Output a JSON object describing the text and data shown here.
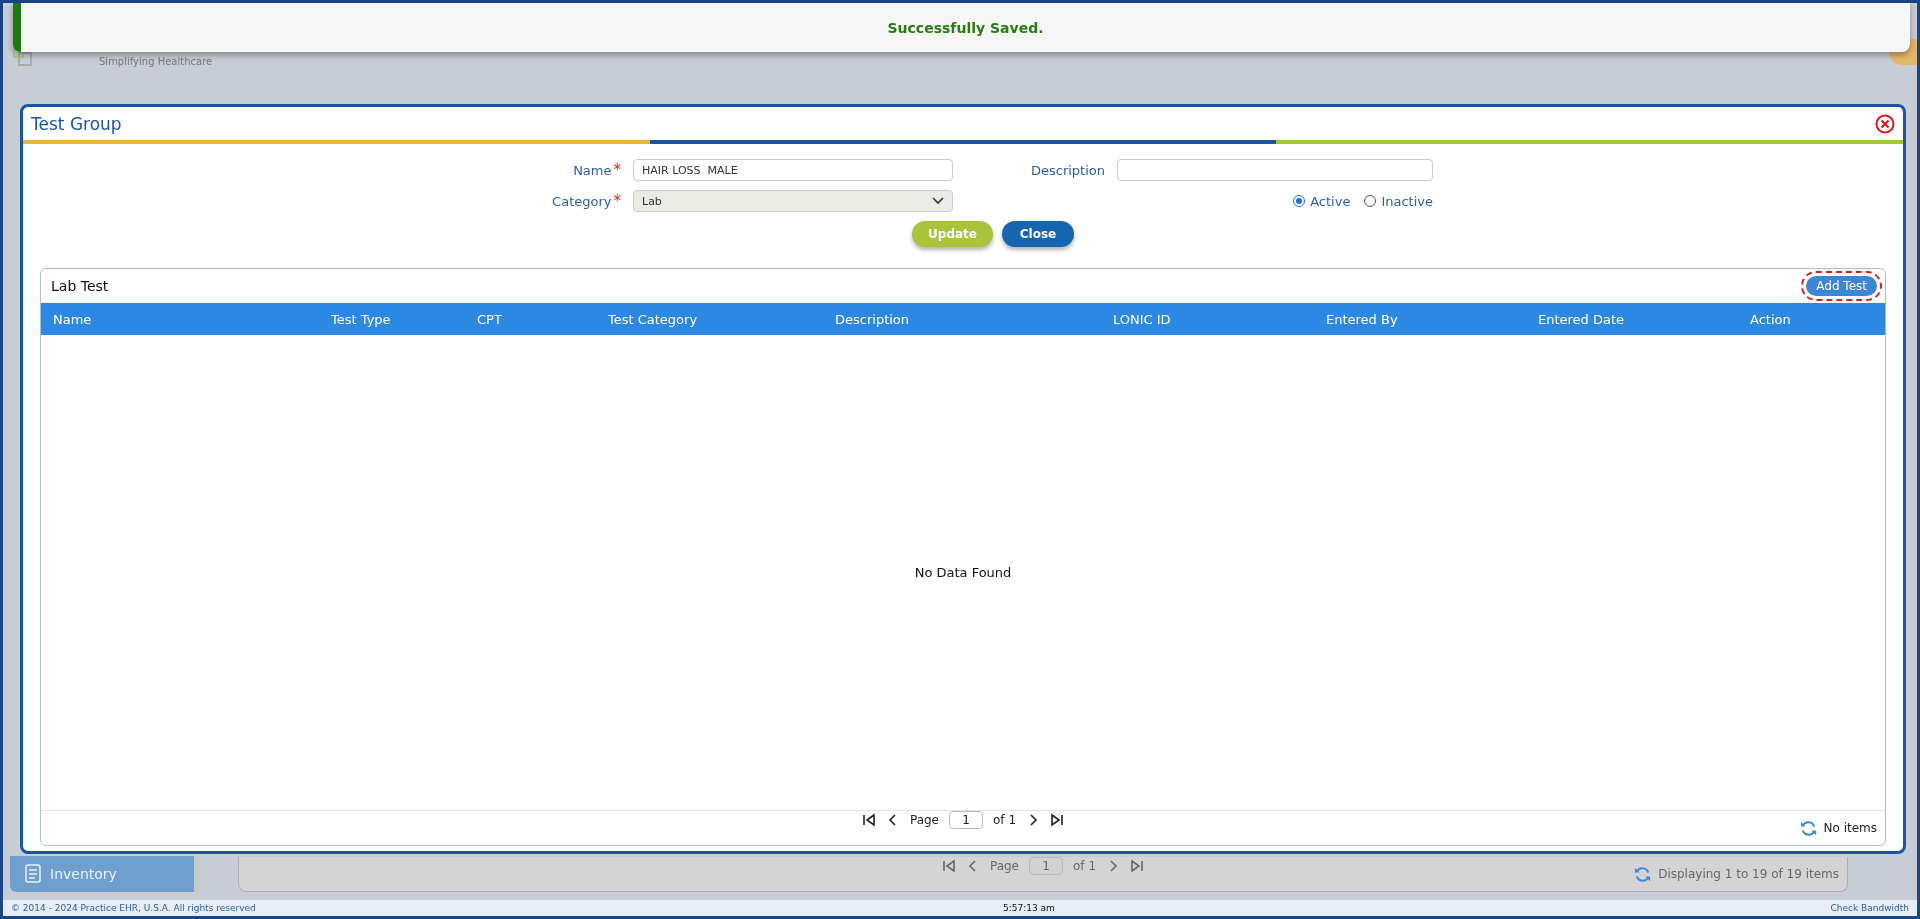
{
  "toast": {
    "message": "Successfully Saved."
  },
  "header": {
    "tagline": "Simplifying Healthcare"
  },
  "dialog": {
    "title": "Test Group",
    "fields": [
      {
        "label": "Name",
        "required_mark": "*",
        "kind": "text",
        "value": "HAIR LOSS  MALE"
      },
      {
        "label": "Category",
        "required_mark": "*",
        "kind": "select",
        "value": "Lab"
      },
      {
        "label": "Description",
        "kind": "text"
      }
    ],
    "status_options": [
      {
        "label": "Active",
        "selected": true
      },
      {
        "label": "Inactive",
        "selected": false
      }
    ],
    "buttons": [
      {
        "label": "Update",
        "kind": "primary"
      },
      {
        "label": "Close",
        "kind": "secondary"
      }
    ],
    "grid": {
      "title": "Lab Test",
      "add_button": "Add Test",
      "columns": [
        "Name",
        "Test Type",
        "CPT",
        "Test Category",
        "Description",
        "LONIC ID",
        "Entered By",
        "Entered Date",
        "Action"
      ],
      "empty_message": "No Data Found",
      "pager": {
        "page_label": "Page",
        "page": "1",
        "of_label": "of 1",
        "status": "No items"
      }
    }
  },
  "background": {
    "sidebar_item": "Inventory",
    "pager": {
      "page_label": "Page",
      "page": "1",
      "of_label": "of 1",
      "status": "Displaying 1 to 19 of 19 items"
    }
  },
  "footer": {
    "copyright": "© 2014 - 2024 Practice EHR, U.S.A. All rights reserved",
    "time": "5:57:13 am",
    "link": "Check Bandwidth"
  }
}
